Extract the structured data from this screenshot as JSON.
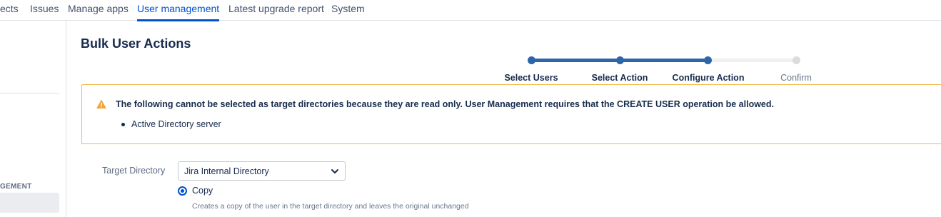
{
  "nav": {
    "tabs": [
      {
        "label": "ects"
      },
      {
        "label": "Issues"
      },
      {
        "label": "Manage apps"
      },
      {
        "label": "User management"
      },
      {
        "label": "Latest upgrade report"
      },
      {
        "label": "System"
      }
    ],
    "active_tab": "User management",
    "accent_color": "#0052cc"
  },
  "sidebar": {
    "section_heading": "GEMENT"
  },
  "page": {
    "title": "Bulk User Actions"
  },
  "stepper": {
    "steps": [
      {
        "label": "Select Users",
        "status": "complete"
      },
      {
        "label": "Select Action",
        "status": "complete"
      },
      {
        "label": "Configure Action",
        "status": "current"
      },
      {
        "label": "Confirm",
        "status": "pending"
      }
    ],
    "progress_color": "#2d65a8"
  },
  "warning": {
    "icon": "warning-icon",
    "color": "#f2b84b",
    "message": "The following cannot be selected as target directories because they are read only. User Management requires that the CREATE USER operation be allowed.",
    "items": [
      "Active Directory server"
    ]
  },
  "form": {
    "target_directory": {
      "label": "Target Directory",
      "value": "Jira Internal Directory"
    },
    "copy_option": {
      "label": "Copy",
      "selected": true,
      "description": "Creates a copy of the user in the target directory and leaves the original unchanged"
    }
  }
}
